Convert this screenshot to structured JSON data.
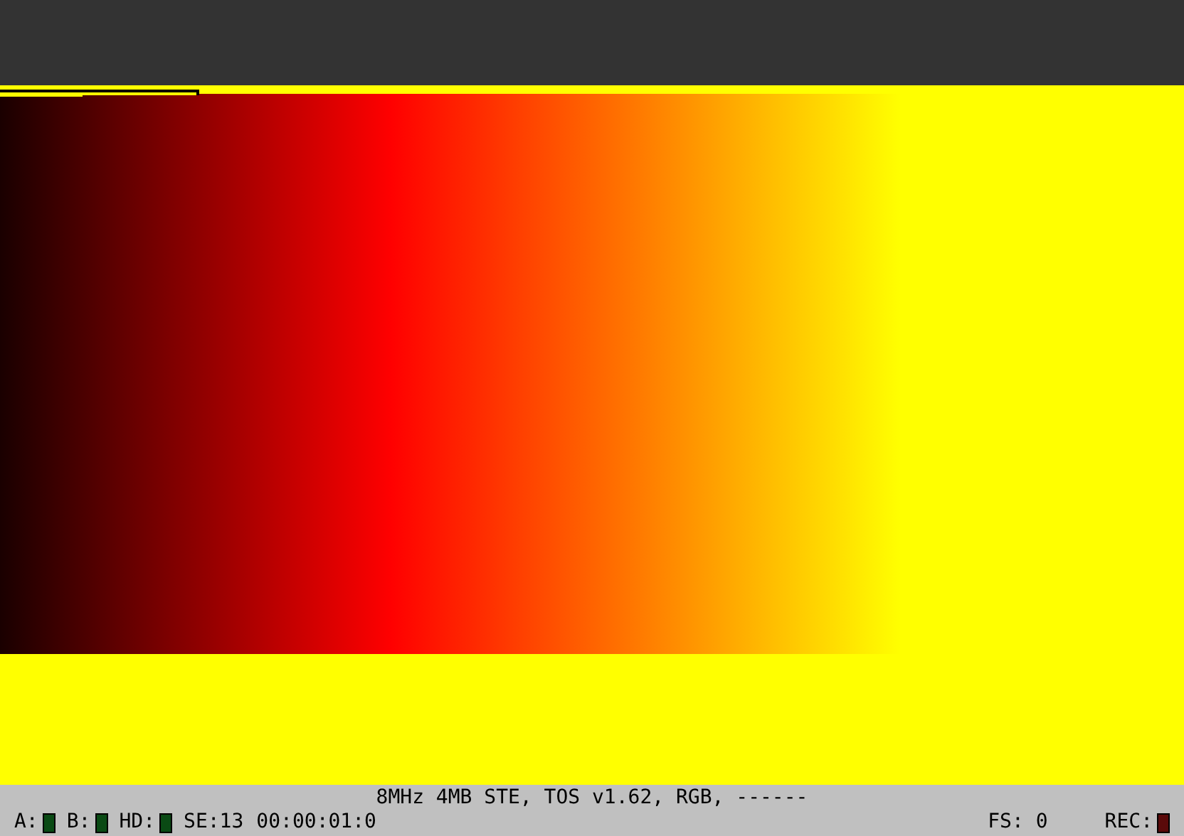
{
  "status_bar": {
    "machine": "8MHz 4MB STE, TOS v1.62, RGB, ------",
    "drives": [
      {
        "label": "A:",
        "color": "#0a4a14"
      },
      {
        "label": "B:",
        "color": "#0a4a14"
      },
      {
        "label": "HD:",
        "color": "#0a4a14"
      }
    ],
    "sectors": "SE:13",
    "time": "00:00:01:0",
    "frameskip": "FS: 0",
    "record": {
      "label": "REC:",
      "color": "#5a0a0a"
    }
  }
}
